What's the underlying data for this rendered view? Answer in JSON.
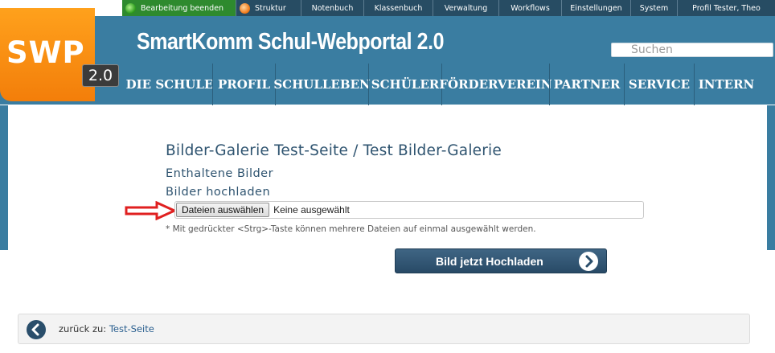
{
  "adminbar": {
    "items": [
      {
        "label": "Bearbeitung beenden",
        "icon": "green-dot-icon"
      },
      {
        "label": "Struktur",
        "icon": "orange-dot-icon"
      },
      {
        "label": "Notenbuch"
      },
      {
        "label": "Klassenbuch"
      },
      {
        "label": "Verwaltung"
      },
      {
        "label": "Workflows"
      },
      {
        "label": "Einstellungen"
      },
      {
        "label": "System"
      },
      {
        "label": "Profil Tester, Theo"
      }
    ]
  },
  "header": {
    "logo_text": "SWP",
    "logo_version": "2.0",
    "site_title": "SmartKomm Schul-Webportal 2.0",
    "search_placeholder": "Suchen"
  },
  "nav": {
    "items": [
      "DIE SCHULE",
      "PROFIL",
      "SCHULLEBEN",
      "SCHÜLER",
      "FÖRDERVEREIN",
      "PARTNER",
      "SERVICE",
      "INTERN"
    ]
  },
  "main": {
    "title": "Bilder-Galerie Test-Seite / Test Bilder-Galerie",
    "link_images": "Enthaltene Bilder",
    "link_upload": "Bilder hochladen",
    "file_button": "Dateien auswählen",
    "file_status": "Keine ausgewählt",
    "hint": "* Mit gedrückter <Strg>-Taste können mehrere Dateien auf einmal ausgewählt werden.",
    "upload_button": "Bild jetzt Hochladen"
  },
  "back": {
    "prefix": "zurück zu:",
    "link": "Test-Seite"
  },
  "colors": {
    "header_blue": "#3a7da1",
    "admin_bar": "#274c63",
    "logo_orange": "#f7900f",
    "annotation_red": "#e02020"
  }
}
